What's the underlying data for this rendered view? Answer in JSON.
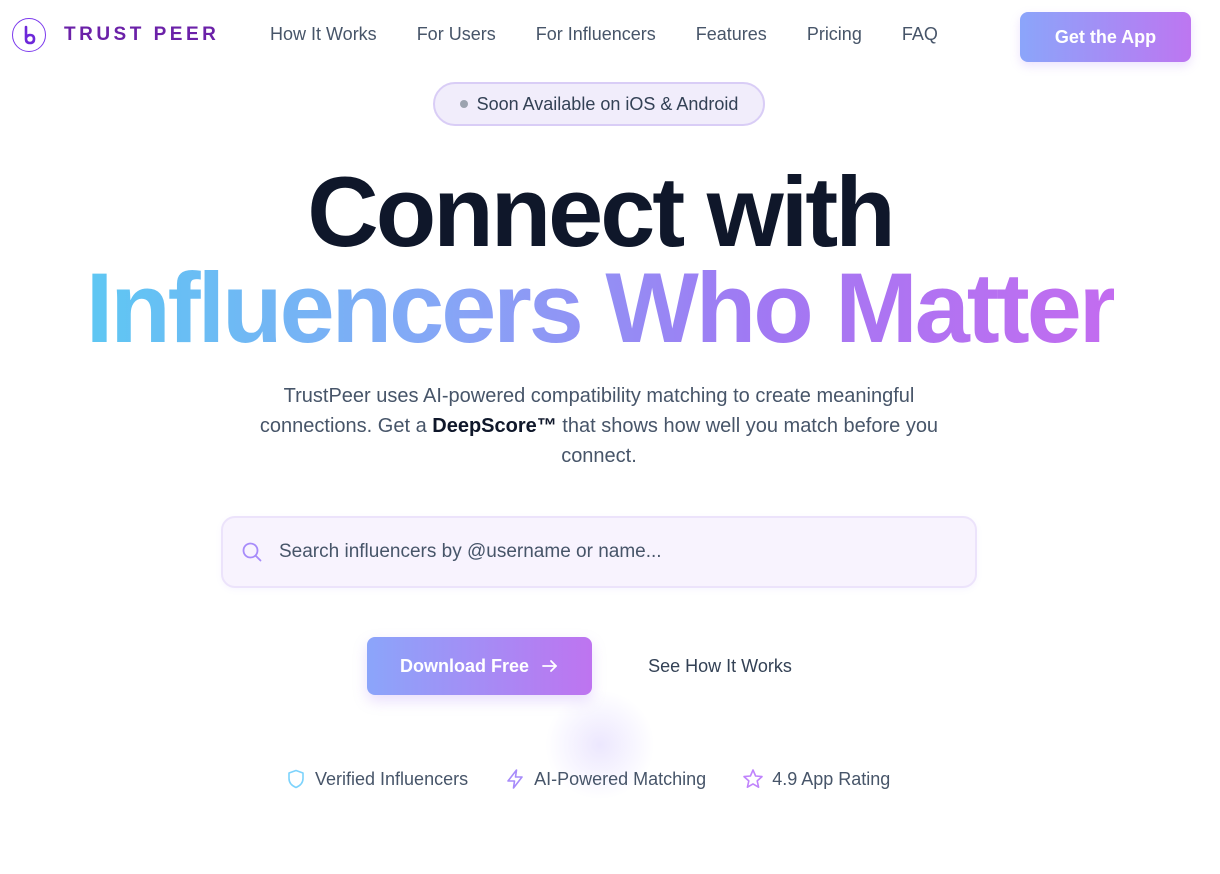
{
  "brand": {
    "name": "TRUST PEER",
    "logo_icon": "logo-mark-icon",
    "accent": "#6b21a8"
  },
  "nav": {
    "links": [
      "How It Works",
      "For Users",
      "For Influencers",
      "Features",
      "Pricing",
      "FAQ"
    ],
    "cta_label": "Get the App"
  },
  "badge": {
    "text": "Soon Available on iOS & Android"
  },
  "hero": {
    "headline_line1": "Connect with",
    "headline_line2": "Influencers Who Matter",
    "subtitle_part1": "TrustPeer uses AI-powered compatibility matching to create meaningful connections. Get a ",
    "subtitle_bold": "DeepScore™",
    "subtitle_part2": " that shows how well you match before you connect."
  },
  "search": {
    "placeholder": "Search influencers by @username or name...",
    "icon": "search-icon"
  },
  "actions": {
    "primary_label": "Download Free",
    "primary_icon": "arrow-right-icon",
    "secondary_label": "See How It Works"
  },
  "features": [
    {
      "icon": "shield-icon",
      "label": "Verified Influencers"
    },
    {
      "icon": "lightning-icon",
      "label": "AI-Powered Matching"
    },
    {
      "icon": "star-icon",
      "label": "4.9 App Rating"
    }
  ],
  "colors": {
    "gradient_start": "#5ec7f3",
    "gradient_mid": "#a079f3",
    "gradient_end": "#c36cf0",
    "button_gradient_start": "#8ba5fa",
    "button_gradient_end": "#be74f0",
    "text_dark": "#0f172a",
    "text_muted": "#475569"
  }
}
